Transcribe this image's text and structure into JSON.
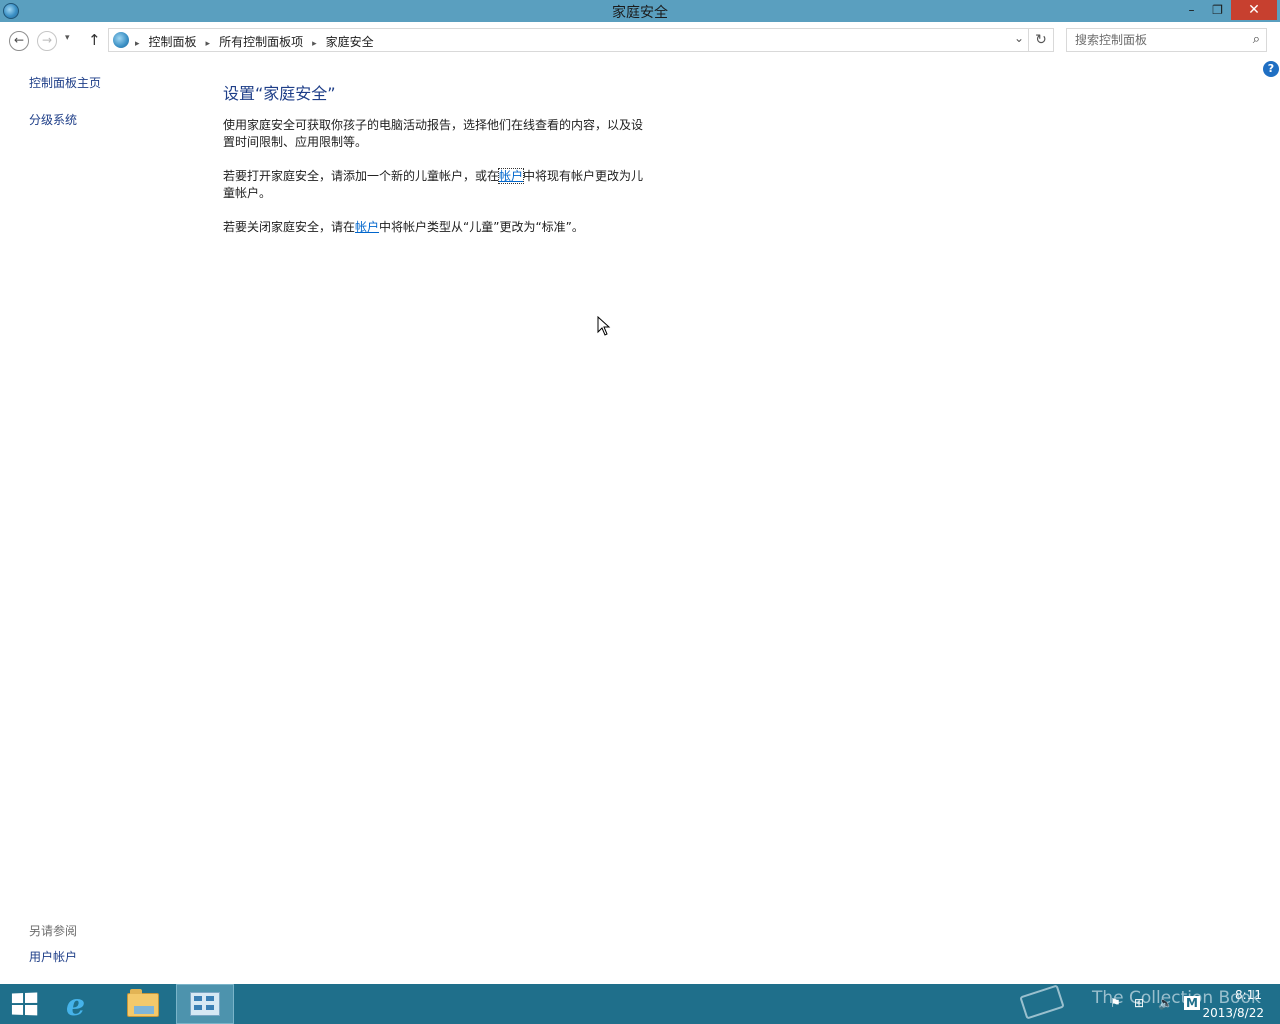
{
  "window": {
    "title": "家庭安全",
    "minimize_glyph": "–",
    "maximize_glyph": "❐",
    "close_glyph": "✕"
  },
  "nav": {
    "back_glyph": "←",
    "forward_glyph": "→",
    "recent_glyph": "▾",
    "up_glyph": "↑",
    "refresh_glyph": "↻",
    "dropdown_glyph": "⌄",
    "breadcrumb": [
      "控制面板",
      "所有控制面板项",
      "家庭安全"
    ],
    "crumb_separator": "▸"
  },
  "search": {
    "placeholder": "搜索控制面板",
    "icon": "search-icon"
  },
  "sidebar": {
    "items": [
      {
        "label": "控制面板主页"
      },
      {
        "label": "分级系统"
      }
    ],
    "see_also_title": "另请参阅",
    "see_also_link": "用户帐户"
  },
  "main": {
    "heading": "设置“家庭安全”",
    "para1": "使用家庭安全可获取你孩子的电脑活动报告，选择他们在线查看的内容，以及设置时间限制、应用限制等。",
    "para2_before": "若要打开家庭安全，请添加一个新的儿童帐户，或在",
    "para2_link": "帐户",
    "para2_after": "中将现有帐户更改为儿童帐户。",
    "para3_before": "若要关闭家庭安全，请在",
    "para3_link": "帐户",
    "para3_after": "中将帐户类型从“儿童”更改为“标准”。"
  },
  "help": {
    "glyph": "?"
  },
  "taskbar": {
    "items": [
      "start",
      "internet-explorer",
      "file-explorer",
      "control-panel"
    ],
    "ie_glyph": "e",
    "watermark": "The Collection Book",
    "time": "8:11",
    "date": "2013/8/22",
    "colors": {
      "taskbar": "#1f6f8b",
      "titlebar": "#5a9fbf",
      "close": "#c7402f"
    }
  }
}
